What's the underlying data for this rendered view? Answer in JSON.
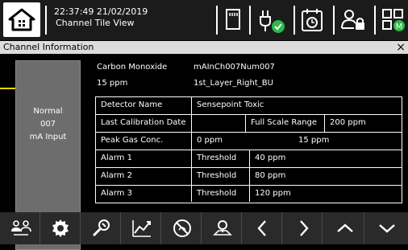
{
  "topbar": {
    "time": "22:37:49",
    "date": "21/02/2019",
    "view": "Channel Tile View",
    "icons": [
      "home-icon",
      "sd-card-icon",
      "power-plug-ok-icon",
      "calendar-clock-icon",
      "user-lock-icon",
      "tile-view-menu-icon"
    ]
  },
  "panel": {
    "title": "Channel Information",
    "close": "×",
    "status": {
      "state": "Normal",
      "channel_number": "007",
      "input_type": "mA Input"
    },
    "gas_name": "Carbon Monoxide",
    "channel_id": "mAInCh007Num007",
    "reading": "15 ppm",
    "location": "1st_Layer_Right_BU",
    "table": {
      "detector_name_label": "Detector Name",
      "detector_name": "Sensepoint Toxic",
      "last_cal_label": "Last Calibration Date",
      "last_cal_value": "",
      "full_scale_label": "Full Scale Range",
      "full_scale_value": "200 ppm",
      "peak_label": "Peak Gas Conc.",
      "peak_value": "0 ppm",
      "peak_extra": "15 ppm",
      "alarms": [
        {
          "label": "Alarm 1",
          "type": "Threshold",
          "value": "40 ppm"
        },
        {
          "label": "Alarm 2",
          "type": "Threshold",
          "value": "80 ppm"
        },
        {
          "label": "Alarm 3",
          "type": "Threshold",
          "value": "120 ppm"
        }
      ]
    }
  },
  "bottomnav": {
    "buttons": [
      "user-group-icon",
      "gear-icon",
      "tools-icon",
      "trend-chart-icon",
      "disabled-gauge-icon",
      "location-icon",
      "chevron-left-icon",
      "chevron-right-icon",
      "chevron-up-icon",
      "chevron-down-icon"
    ]
  },
  "colors": {
    "topbar_bg": "#1b1b1b",
    "status_box_bg": "#6d6d6d",
    "arrow": "#ffd700",
    "ok_green": "#2db84b"
  }
}
